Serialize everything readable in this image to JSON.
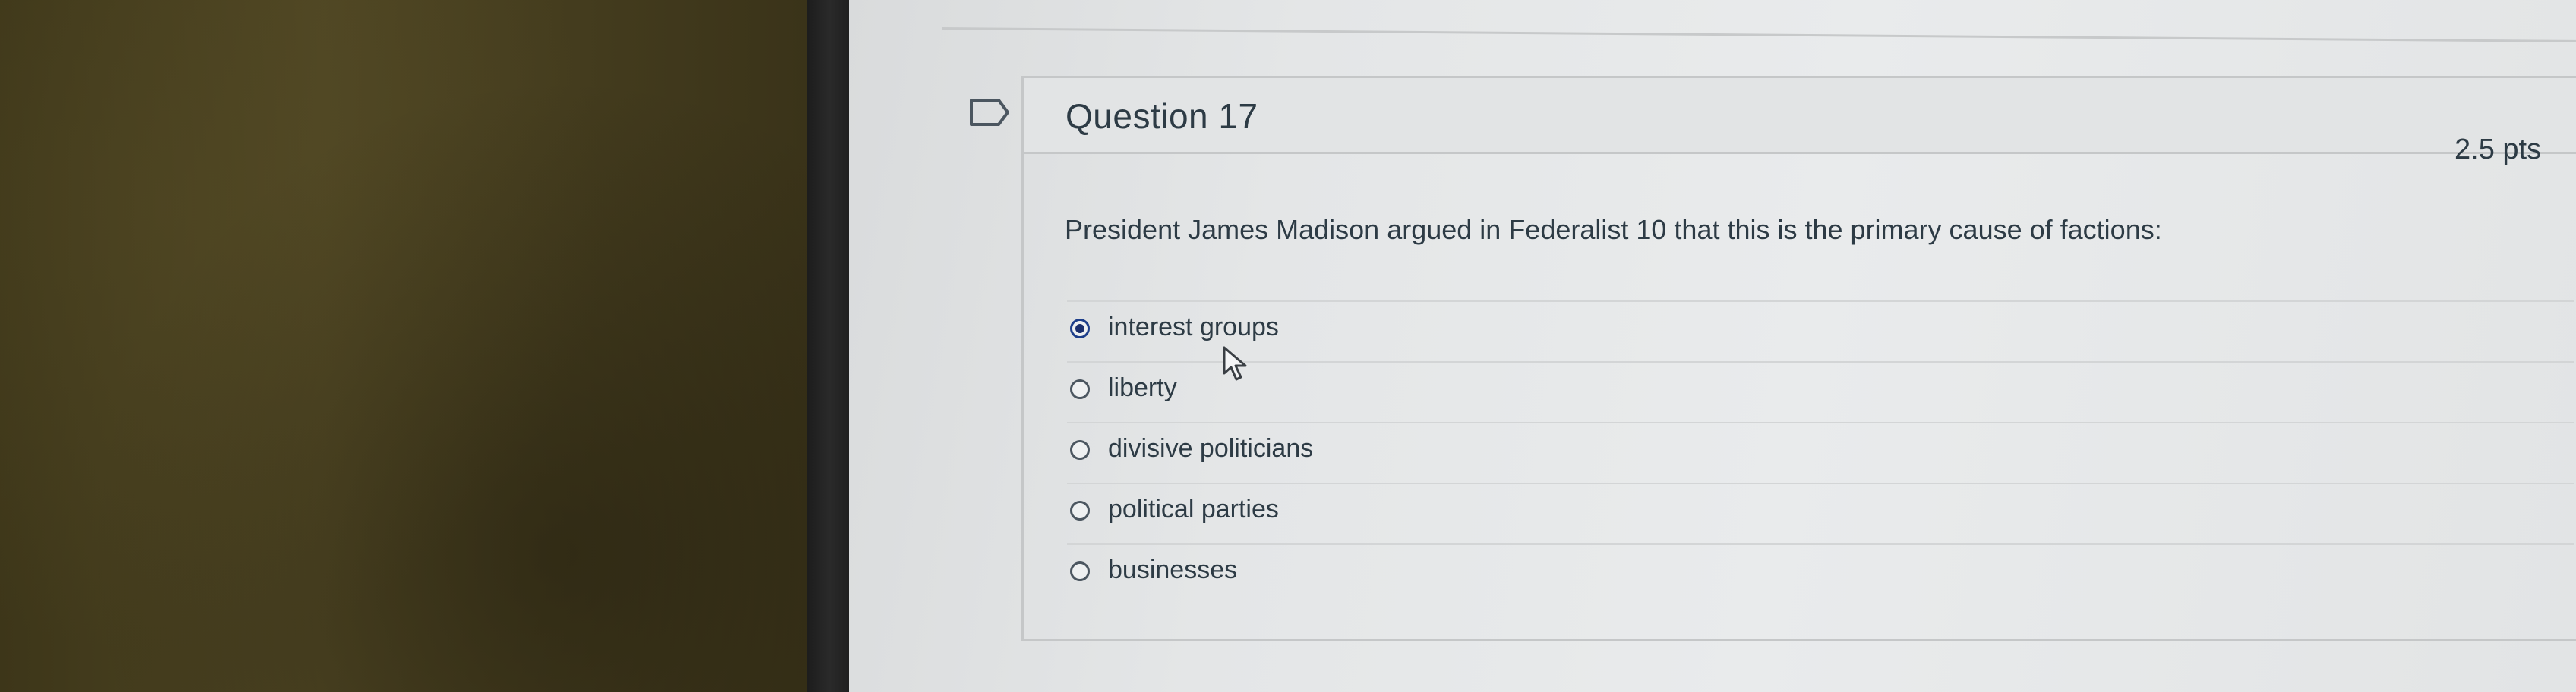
{
  "question": {
    "title": "Question 17",
    "points": "2.5 pts",
    "text": "President James Madison argued in Federalist 10 that this is the primary cause of factions:"
  },
  "answers": [
    {
      "label": "interest groups",
      "selected": true
    },
    {
      "label": "liberty",
      "selected": false
    },
    {
      "label": "divisive politicians",
      "selected": false
    },
    {
      "label": "political parties",
      "selected": false
    },
    {
      "label": "businesses",
      "selected": false
    }
  ],
  "icons": {
    "flag": "flag-icon",
    "cursor": "mouse-pointer-icon"
  },
  "colors": {
    "text": "#2d3b45",
    "selected_radio": "#1d3e8a"
  }
}
